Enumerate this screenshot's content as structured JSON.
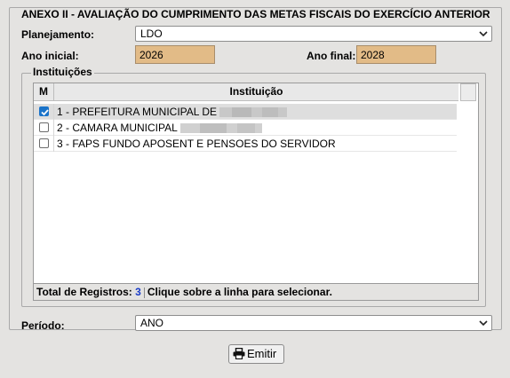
{
  "form": {
    "legend": "ANEXO II - AVALIAÇÃO DO CUMPRIMENTO DAS METAS FISCAIS DO EXERCÍCIO ANTERIOR",
    "planejamento_label": "Planejamento:",
    "planejamento_value": "LDO",
    "ano_inicial_label": "Ano inicial:",
    "ano_inicial_value": "2026",
    "ano_final_label": "Ano final:",
    "ano_final_value": "2028",
    "periodo_label": "Período:",
    "periodo_value": "ANO"
  },
  "instituicoes": {
    "legend": "Instituições",
    "col_m": "M",
    "col_instituicao": "Instituição",
    "rows": [
      {
        "label": "1 - PREFEITURA MUNICIPAL DE",
        "checked": true
      },
      {
        "label": "2 - CAMARA MUNICIPAL",
        "checked": false
      },
      {
        "label": "3 - FAPS FUNDO APOSENT E PENSOES DO SERVIDOR",
        "checked": false
      }
    ],
    "total_label": "Total de Registros:",
    "total_count": "3",
    "hint": "Clique sobre a linha para selecionar."
  },
  "actions": {
    "emitir_label": "Emitir"
  },
  "colors": {
    "accent": "#1a73c9",
    "year_field": "#e2bb87"
  },
  "icons": {
    "dropdown": "chevron-down-icon",
    "checkbox": "check-icon",
    "emitir": "printer-icon"
  }
}
